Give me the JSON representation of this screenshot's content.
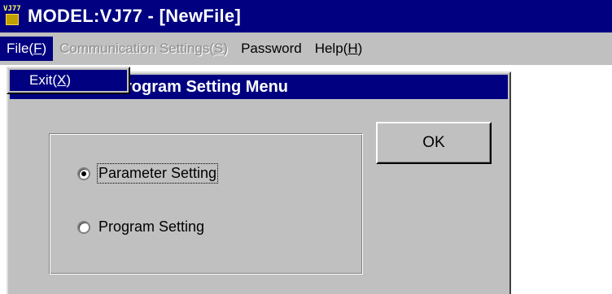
{
  "window": {
    "title": "MODEL:VJ77 - [NewFile]",
    "icon": "app-icon",
    "icon_text": "VJ77"
  },
  "menubar": {
    "items": [
      {
        "pre": "File(",
        "accel": "F",
        "post": ")",
        "state": "active"
      },
      {
        "pre": "Communication Settings(",
        "accel": "S",
        "post": ")",
        "state": "disabled"
      },
      {
        "pre": "Password",
        "accel": "",
        "post": "",
        "state": "normal"
      },
      {
        "pre": "Help(",
        "accel": "H",
        "post": ")",
        "state": "normal"
      }
    ]
  },
  "file_menu": {
    "items": [
      {
        "pre": "Exit(",
        "accel": "X",
        "post": ")"
      }
    ]
  },
  "dialog": {
    "title_visible": "rogram Setting Menu",
    "ok_label": "OK",
    "options": [
      {
        "label": "Parameter Setting",
        "selected": true
      },
      {
        "label": "Program Setting",
        "selected": false
      }
    ]
  },
  "colors": {
    "titlebar": "#000080",
    "face": "#c0c0c0",
    "disabled_text": "#8c8c8c"
  }
}
